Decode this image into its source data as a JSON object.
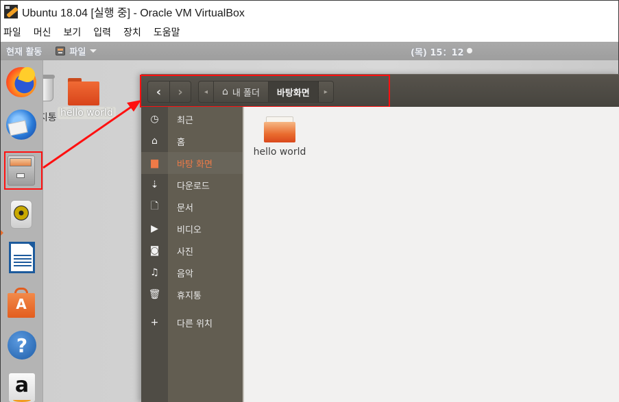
{
  "window": {
    "title": "Ubuntu 18.04 [실행 중] - Oracle VM VirtualBox"
  },
  "menubar": {
    "items": [
      "파일",
      "머신",
      "보기",
      "입력",
      "장치",
      "도움말"
    ]
  },
  "topbar": {
    "activities": "현재 활동",
    "app_menu_label": "파일",
    "clock": "(목) 15：12"
  },
  "dock": {
    "items": [
      {
        "name": "Firefox",
        "icon": "firefox-icon"
      },
      {
        "name": "Thunderbird",
        "icon": "thunderbird-icon"
      },
      {
        "name": "Files",
        "icon": "file-cabinet-icon",
        "running": true,
        "highlighted": true
      },
      {
        "name": "Rhythmbox",
        "icon": "speaker-icon"
      },
      {
        "name": "LibreOffice Writer",
        "icon": "document-icon"
      },
      {
        "name": "Ubuntu Software",
        "icon": "shopping-bag-icon"
      },
      {
        "name": "Help",
        "icon": "help-icon"
      },
      {
        "name": "Amazon",
        "icon": "amazon-icon"
      }
    ],
    "help_glyph": "?",
    "software_glyph": "A",
    "amazon_glyph": "a"
  },
  "desktop": {
    "trash_label": "휴지통",
    "folder_label": "hello world"
  },
  "files_window": {
    "header": {
      "back_glyph": "‹",
      "forward_glyph": "›",
      "path_left_glyph": "◂",
      "path_right_glyph": "▸",
      "home_glyph": "⌂",
      "crumbs": [
        "내 폴더",
        "바탕화면"
      ],
      "active_crumb_index": 1
    },
    "sidebar": {
      "items": [
        {
          "label": "최근",
          "icon": "clock-icon",
          "glyph": "◷"
        },
        {
          "label": "홈",
          "icon": "home-icon",
          "glyph": "⌂"
        },
        {
          "label": "바탕 화면",
          "icon": "folder-icon",
          "glyph": "▆",
          "active": true
        },
        {
          "label": "다운로드",
          "icon": "download-icon",
          "glyph": "⇣"
        },
        {
          "label": "문서",
          "icon": "document-icon",
          "glyph": "🗋"
        },
        {
          "label": "비디오",
          "icon": "video-icon",
          "glyph": "▶"
        },
        {
          "label": "사진",
          "icon": "camera-icon",
          "glyph": "◙"
        },
        {
          "label": "음악",
          "icon": "music-icon",
          "glyph": "♫"
        },
        {
          "label": "휴지통",
          "icon": "trash-icon",
          "glyph": "🗑"
        },
        {
          "label": "다른 위치",
          "icon": "plus-icon",
          "glyph": "+"
        }
      ]
    },
    "content": {
      "items": [
        {
          "name": "hello world",
          "type": "folder"
        }
      ]
    }
  },
  "annotation": {
    "color": "#ff1010"
  }
}
